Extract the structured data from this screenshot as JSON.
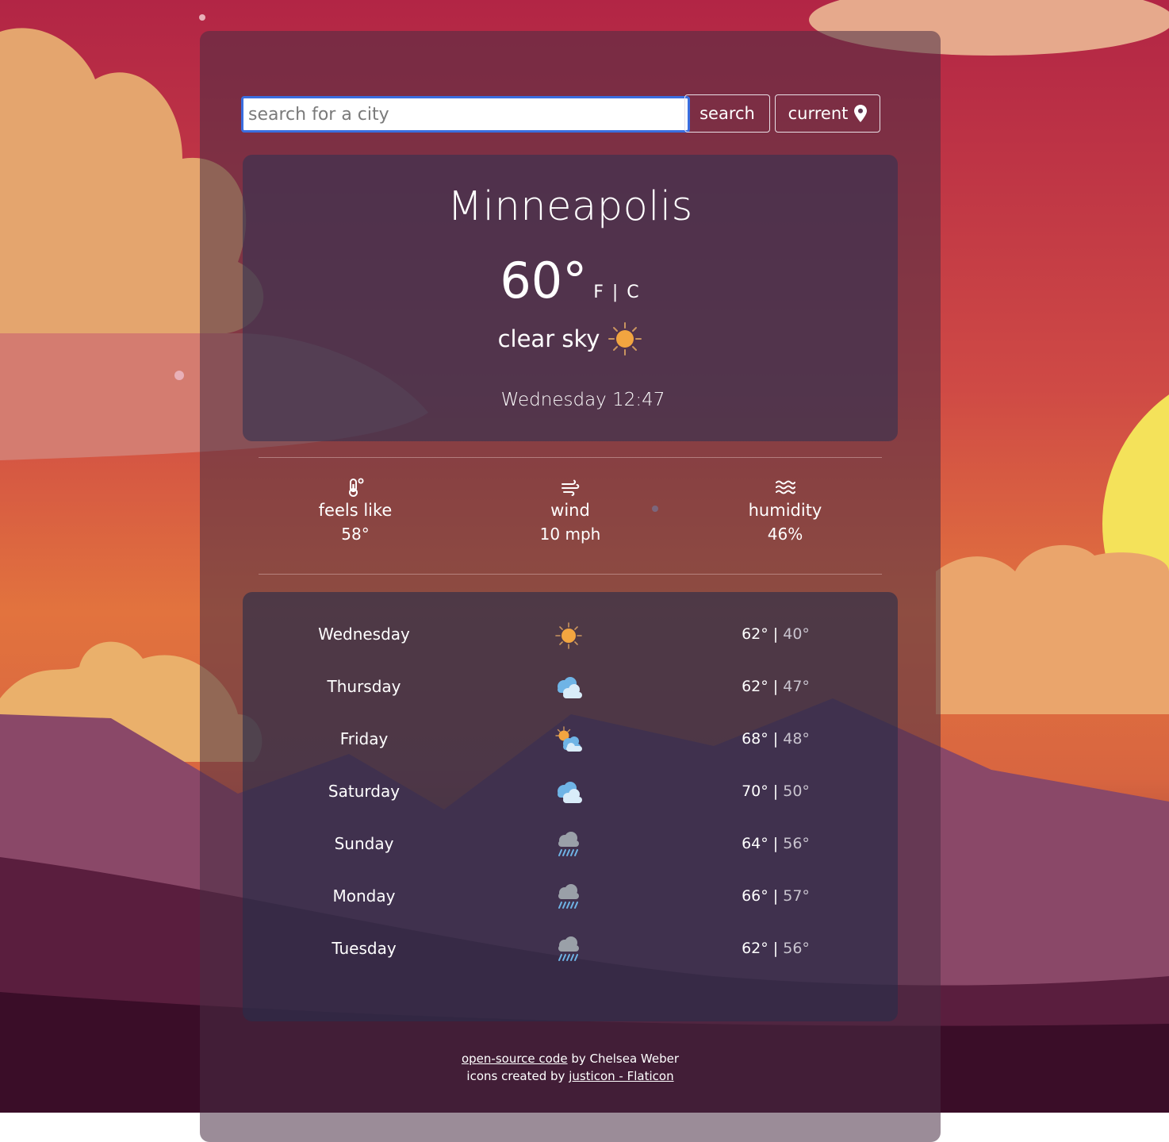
{
  "search": {
    "placeholder": "search for a city",
    "value": "",
    "button_label": "search",
    "current_label": "current",
    "current_icon": "map-pin-icon"
  },
  "current": {
    "city": "Minneapolis",
    "temperature": "60°",
    "units": "F | C",
    "condition": "clear sky",
    "condition_icon": "sun-icon",
    "datetime": "Wednesday 12:47"
  },
  "stats": [
    {
      "icon": "thermometer-icon",
      "label": "feels like",
      "value": "58°"
    },
    {
      "icon": "wind-icon",
      "label": "wind",
      "value": "10 mph"
    },
    {
      "icon": "humidity-icon",
      "label": "humidity",
      "value": "46%"
    }
  ],
  "forecast": [
    {
      "day": "Wednesday",
      "icon": "sun-icon",
      "high": "62°",
      "sep": " | ",
      "low": "40°"
    },
    {
      "day": "Thursday",
      "icon": "clouds-icon",
      "high": "62°",
      "sep": " | ",
      "low": "47°"
    },
    {
      "day": "Friday",
      "icon": "partly-cloudy-icon",
      "high": "68°",
      "sep": " | ",
      "low": "48°"
    },
    {
      "day": "Saturday",
      "icon": "clouds-icon",
      "high": "70°",
      "sep": " | ",
      "low": "50°"
    },
    {
      "day": "Sunday",
      "icon": "rain-icon",
      "high": "64°",
      "sep": " | ",
      "low": "56°"
    },
    {
      "day": "Monday",
      "icon": "rain-icon",
      "high": "66°",
      "sep": " | ",
      "low": "57°"
    },
    {
      "day": "Tuesday",
      "icon": "rain-icon",
      "high": "62°",
      "sep": " | ",
      "low": "56°"
    }
  ],
  "footer": {
    "code_link": "open-source code",
    "by_text": " by Chelsea Weber",
    "icons_text": "icons created by ",
    "icons_link": "justicon - Flaticon"
  },
  "colors": {
    "accent": "#3a6ee0",
    "panel": "#482d44",
    "sun": "#f2a540",
    "sky_top": "#b52a45",
    "sky_mid": "#e56a3a"
  }
}
